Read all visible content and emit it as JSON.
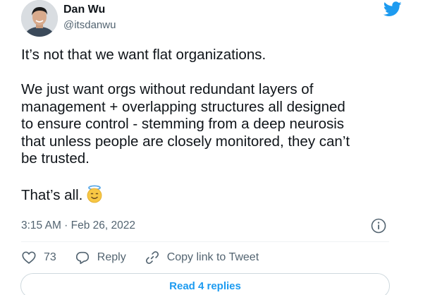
{
  "author": {
    "name": "Dan Wu",
    "handle": "@itsdanwu"
  },
  "tweet": {
    "lines_p1": [
      "It’s not that we want flat organizations."
    ],
    "lines_p2": [
      "We just want orgs without redundant layers of",
      "management + overlapping structures all designed",
      "to ensure control - stemming from a deep neurosis",
      "that unless people are closely monitored, they can’t",
      "be trusted."
    ],
    "lines_p3": [
      "That’s all."
    ],
    "emoji": "smiling-face-with-halo"
  },
  "timestamp": "3:15 AM · Feb 26, 2022",
  "actions": {
    "like_count": "73",
    "reply_label": "Reply",
    "copy_label": "Copy link to Tweet"
  },
  "read_replies_label": "Read 4 replies",
  "colors": {
    "accent": "#1d9bf0",
    "text": "#0f1419",
    "secondary": "#536471"
  }
}
